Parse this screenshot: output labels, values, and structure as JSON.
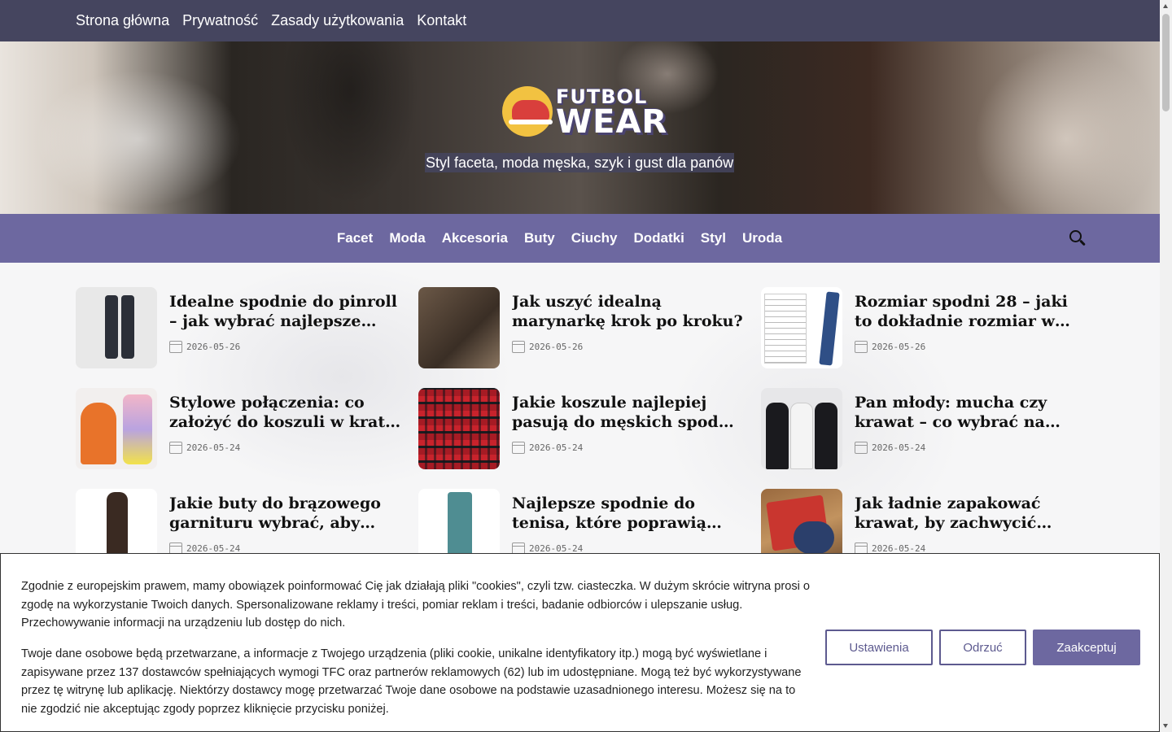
{
  "top_nav": {
    "links": [
      "Strona główna",
      "Prywatność",
      "Zasady użytkowania",
      "Kontakt"
    ]
  },
  "header": {
    "logo_line1": "FUTBOL",
    "logo_line2": "WEAR",
    "tagline": "Styl faceta, moda męska, szyk i gust dla panów"
  },
  "category_nav": {
    "items": [
      "Facet",
      "Moda",
      "Akcesoria",
      "Buty",
      "Ciuchy",
      "Dodatki",
      "Styl",
      "Uroda"
    ],
    "search_icon": "search-icon"
  },
  "posts": [
    {
      "title": "Idealne spodnie do pinroll – jak wybrać najlepsze fasony?",
      "date": "2026-05-26"
    },
    {
      "title": "Jak uszyć idealną marynarkę krok po kroku?",
      "date": "2026-05-26"
    },
    {
      "title": "Rozmiar spodni 28 – jaki to dokładnie rozmiar w centymetrach?",
      "date": "2026-05-26"
    },
    {
      "title": "Stylowe połączenia: co założyć do koszuli w kratę, aby wyglądać modnie?",
      "date": "2026-05-24"
    },
    {
      "title": "Jakie koszule najlepiej pasują do męskich spodni w kratę?",
      "date": "2026-05-24"
    },
    {
      "title": "Pan młody: mucha czy krawat – co wybrać na swój ślub?",
      "date": "2026-05-24"
    },
    {
      "title": "Jakie buty do brązowego garnituru wybrać, aby wyglądać stylowo?",
      "date": "2026-05-24"
    },
    {
      "title": "Najlepsze spodnie do tenisa, które poprawią Twój komfort gry",
      "date": "2026-05-24"
    },
    {
      "title": "Jak ładnie zapakować krawat, by zachwycić obdarowanego?",
      "date": "2026-05-24"
    }
  ],
  "cookie_banner": {
    "paragraph1": "Zgodnie z europejskim prawem, mamy obowiązek poinformować Cię jak działają pliki \"cookies\", czyli tzw. ciasteczka. W dużym skrócie witryna prosi o zgodę na wykorzystanie Twoich danych. Spersonalizowane reklamy i treści, pomiar reklam i treści, badanie odbiorców i ulepszanie usług. Przechowywanie informacji na urządzeniu lub dostęp do nich.",
    "paragraph2": "Twoje dane osobowe będą przetwarzane, a informacje z Twojego urządzenia (pliki cookie, unikalne identyfikatory itp.) mogą być wyświetlane i zapisywane przez 137 dostawców spełniających wymogi TFC oraz partnerów reklamowych (62) lub im udostępniane. Mogą też być wykorzystywane przez tę witrynę lub aplikację. Niektórzy dostawcy mogę przetwarzać Twoje dane osobowe na podstawie uzasadnionego interesu. Możesz się na to nie zgodzić nie akceptując zgody poprzez kliknięcie przycisku poniżej.",
    "settings_label": "Ustawienia",
    "reject_label": "Odrzuć",
    "accept_label": "Zaakceptuj"
  },
  "colors": {
    "topbar": "#45455f",
    "category_nav": "#6d68a0",
    "accent": "#5d5a8f"
  }
}
